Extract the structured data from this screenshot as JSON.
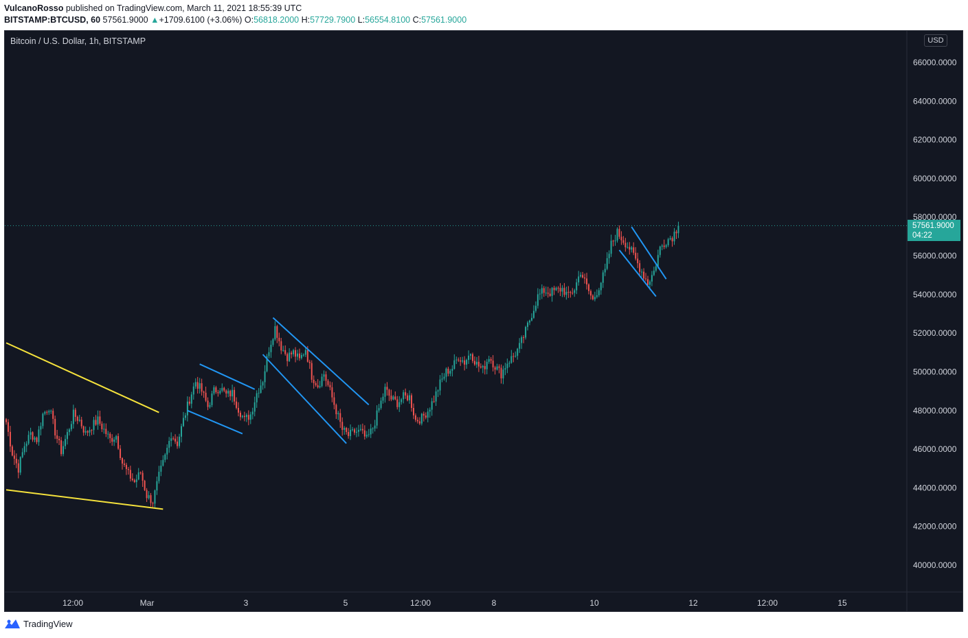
{
  "header": {
    "author": "VulcanoRosso",
    "published": "published on TradingView.com, March 11, 2021 18:55:39 UTC",
    "symbol": "BITSTAMP:BTCUSD, 60",
    "last": "57561.9000",
    "change_arrow": "▲",
    "change": "+1709.6100 (+3.06%)",
    "o_label": "O:",
    "o_value": "56818.2000",
    "h_label": "H:",
    "h_value": "57729.7900",
    "l_label": "L:",
    "l_value": "56554.8100",
    "c_label": "C:",
    "c_value": "57561.9000"
  },
  "legend_title": "Bitcoin / U.S. Dollar, 1h, BITSTAMP",
  "currency_badge": "USD",
  "price_tag": {
    "price": "57561.9000",
    "countdown": "04:22"
  },
  "footer": {
    "brand": "TradingView"
  },
  "colors": {
    "background": "#131722",
    "up": "#26a69a",
    "down": "#ef5350",
    "trendline": "#f5e23c",
    "channel": "#2196f3"
  },
  "chart_data": {
    "type": "candlestick",
    "title": "Bitcoin / U.S. Dollar, 1h, BITSTAMP",
    "y_tick_labels": [
      "66000.0000",
      "64000.0000",
      "62000.0000",
      "60000.0000",
      "58000.0000",
      "56000.0000",
      "54000.0000",
      "52000.0000",
      "50000.0000",
      "48000.0000",
      "46000.0000",
      "44000.0000",
      "42000.0000",
      "40000.0000"
    ],
    "x_tick_labels": [
      "12:00",
      "Mar",
      "3",
      "5",
      "12:00",
      "8",
      "10",
      "12",
      "12:00",
      "15"
    ],
    "ylim": [
      38600,
      67000
    ],
    "last_price": 57561.9,
    "price_path": [
      [
        0,
        47400
      ],
      [
        3,
        45800
      ],
      [
        6,
        45000
      ],
      [
        9,
        46200
      ],
      [
        12,
        46800
      ],
      [
        15,
        46500
      ],
      [
        18,
        47800
      ],
      [
        21,
        48200
      ],
      [
        24,
        46900
      ],
      [
        27,
        45900
      ],
      [
        30,
        46800
      ],
      [
        33,
        47800
      ],
      [
        36,
        47500
      ],
      [
        39,
        46800
      ],
      [
        42,
        47200
      ],
      [
        45,
        47500
      ],
      [
        48,
        47000
      ],
      [
        51,
        46500
      ],
      [
        54,
        46700
      ],
      [
        57,
        45300
      ],
      [
        60,
        44700
      ],
      [
        63,
        44300
      ],
      [
        66,
        44800
      ],
      [
        69,
        43600
      ],
      [
        72,
        43300
      ],
      [
        75,
        44600
      ],
      [
        78,
        45600
      ],
      [
        81,
        46800
      ],
      [
        84,
        46300
      ],
      [
        87,
        47500
      ],
      [
        90,
        48600
      ],
      [
        93,
        49500
      ],
      [
        96,
        49000
      ],
      [
        99,
        48200
      ],
      [
        102,
        49000
      ],
      [
        105,
        49200
      ],
      [
        108,
        48800
      ],
      [
        111,
        48900
      ],
      [
        114,
        48100
      ],
      [
        117,
        47500
      ],
      [
        120,
        47800
      ],
      [
        123,
        48900
      ],
      [
        126,
        49600
      ],
      [
        129,
        51200
      ],
      [
        132,
        52300
      ],
      [
        135,
        51300
      ],
      [
        138,
        50800
      ],
      [
        141,
        51000
      ],
      [
        144,
        50600
      ],
      [
        147,
        51200
      ],
      [
        150,
        49800
      ],
      [
        153,
        49300
      ],
      [
        156,
        49900
      ],
      [
        159,
        49000
      ],
      [
        162,
        48000
      ],
      [
        165,
        47000
      ],
      [
        168,
        46700
      ],
      [
        171,
        46900
      ],
      [
        174,
        46900
      ],
      [
        177,
        46500
      ],
      [
        180,
        47100
      ],
      [
        183,
        48100
      ],
      [
        186,
        49100
      ],
      [
        189,
        48600
      ],
      [
        192,
        48400
      ],
      [
        195,
        48700
      ],
      [
        198,
        48700
      ],
      [
        201,
        47500
      ],
      [
        204,
        47600
      ],
      [
        207,
        48000
      ],
      [
        210,
        48600
      ],
      [
        213,
        49400
      ],
      [
        216,
        50000
      ],
      [
        219,
        50200
      ],
      [
        222,
        50800
      ],
      [
        225,
        50500
      ],
      [
        228,
        51000
      ],
      [
        231,
        50400
      ],
      [
        234,
        50100
      ],
      [
        237,
        50800
      ],
      [
        240,
        50300
      ],
      [
        243,
        49900
      ],
      [
        246,
        50500
      ],
      [
        249,
        50800
      ],
      [
        252,
        51300
      ],
      [
        255,
        52100
      ],
      [
        258,
        53000
      ],
      [
        261,
        53900
      ],
      [
        264,
        54200
      ],
      [
        267,
        54100
      ],
      [
        270,
        54200
      ],
      [
        273,
        54300
      ],
      [
        276,
        53900
      ],
      [
        279,
        54300
      ],
      [
        282,
        55200
      ],
      [
        285,
        54400
      ],
      [
        288,
        53700
      ],
      [
        291,
        54400
      ],
      [
        294,
        55200
      ],
      [
        297,
        56600
      ],
      [
        300,
        57200
      ],
      [
        303,
        56800
      ],
      [
        306,
        56400
      ],
      [
        309,
        55800
      ],
      [
        312,
        55200
      ],
      [
        315,
        54600
      ],
      [
        318,
        55200
      ],
      [
        321,
        56400
      ],
      [
        324,
        56800
      ],
      [
        327,
        57000
      ],
      [
        330,
        57561.9
      ]
    ],
    "trendlines": [
      {
        "color": "yellow",
        "points": [
          [
            0,
            51500
          ],
          [
            75,
            47900
          ]
        ]
      },
      {
        "color": "yellow",
        "points": [
          [
            0,
            43900
          ],
          [
            77,
            42900
          ]
        ]
      },
      {
        "color": "blue",
        "points": [
          [
            95,
            50400
          ],
          [
            122,
            49100
          ]
        ]
      },
      {
        "color": "blue",
        "points": [
          [
            89,
            48000
          ],
          [
            116,
            46800
          ]
        ]
      },
      {
        "color": "blue",
        "points": [
          [
            131,
            52800
          ],
          [
            178,
            48300
          ]
        ]
      },
      {
        "color": "blue",
        "points": [
          [
            126,
            50900
          ],
          [
            167,
            46300
          ]
        ]
      },
      {
        "color": "blue",
        "points": [
          [
            307,
            57500
          ],
          [
            324,
            54800
          ]
        ]
      },
      {
        "color": "blue",
        "points": [
          [
            301,
            56300
          ],
          [
            319,
            53900
          ]
        ]
      }
    ]
  }
}
